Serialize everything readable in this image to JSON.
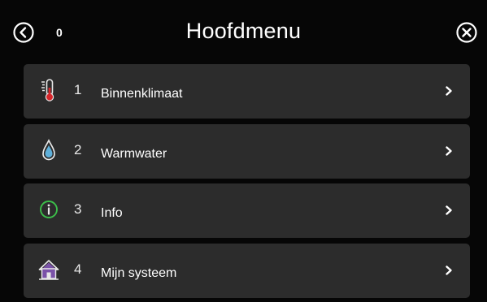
{
  "header": {
    "title": "Hoofdmenu",
    "count": "0",
    "back_icon": "back-circle-icon",
    "close_icon": "close-circle-icon"
  },
  "menu": {
    "items": [
      {
        "number": "1",
        "label": "Binnenklimaat",
        "icon": "thermometer-icon"
      },
      {
        "number": "2",
        "label": "Warmwater",
        "icon": "water-drop-icon"
      },
      {
        "number": "3",
        "label": "Info",
        "icon": "info-icon"
      },
      {
        "number": "4",
        "label": "Mijn systeem",
        "icon": "house-icon"
      }
    ]
  },
  "colors": {
    "background": "#060606",
    "item_background": "#2c2c2c",
    "text": "#ffffff",
    "thermometer_red": "#d6262b",
    "drop_blue": "#5fb0da",
    "info_green": "#3cbe4a",
    "house_purple": "#7a52a8"
  }
}
